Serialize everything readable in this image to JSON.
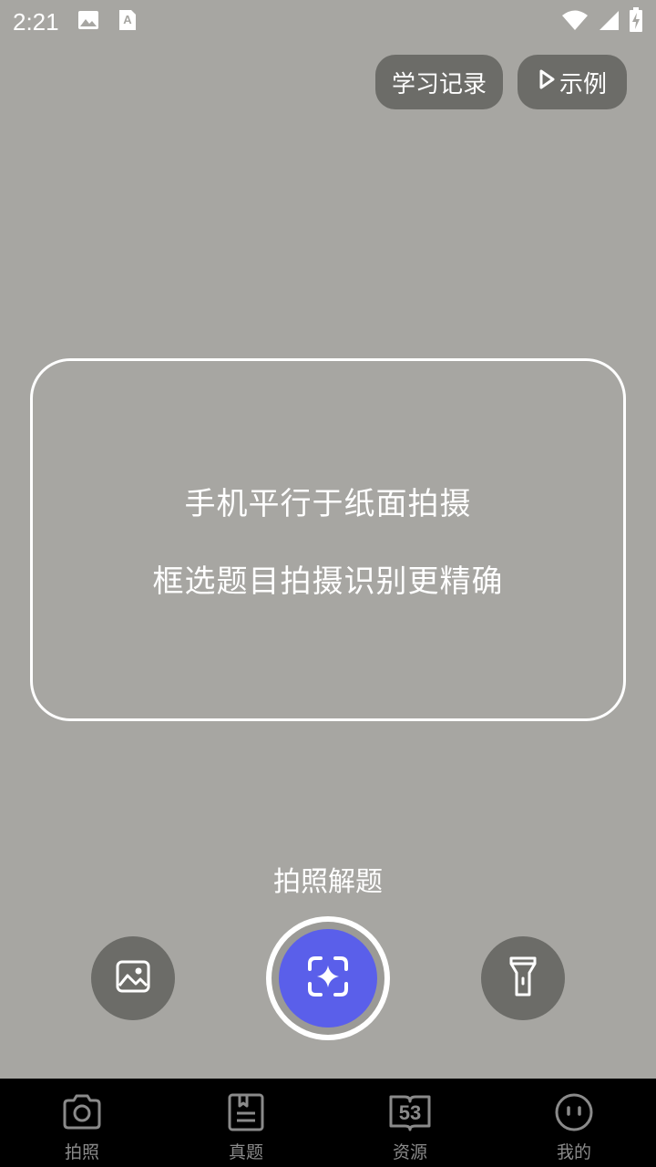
{
  "status_bar": {
    "time": "2:21",
    "icons": [
      "image-icon",
      "font-a-icon",
      "wifi-icon",
      "signal-icon",
      "battery-charging-icon"
    ]
  },
  "top_buttons": {
    "record_label": "学习记录",
    "example_label": "示例"
  },
  "frame": {
    "line1": "手机平行于纸面拍摄",
    "line2": "框选题目拍摄识别更精确"
  },
  "mode_label": "拍照解题",
  "controls": {
    "gallery_icon": "gallery-icon",
    "shutter_icon": "scan-sparkle-icon",
    "flash_icon": "flashlight-icon"
  },
  "nav": {
    "items": [
      {
        "label": "拍照",
        "icon": "camera-icon"
      },
      {
        "label": "真题",
        "icon": "document-icon"
      },
      {
        "label": "资源",
        "icon": "book-53-icon"
      },
      {
        "label": "我的",
        "icon": "face-icon"
      }
    ]
  },
  "colors": {
    "background": "#a7a6a2",
    "pill": "#6c6c68",
    "shutter": "#5a5fea",
    "nav_background": "#000000",
    "nav_label": "#8a8a8a"
  }
}
